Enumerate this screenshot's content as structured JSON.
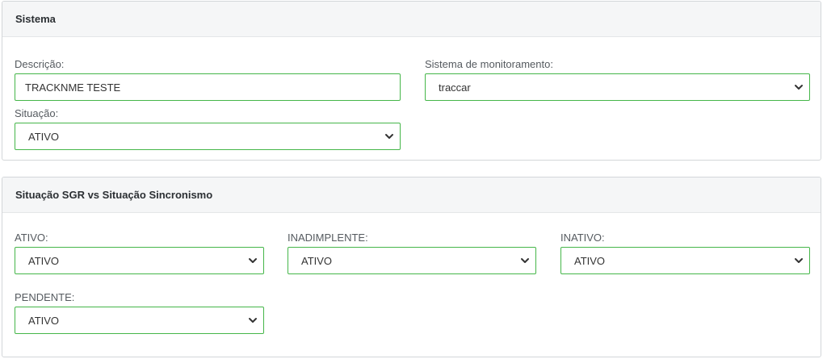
{
  "sistema": {
    "title": "Sistema",
    "descricao": {
      "label": "Descrição:",
      "value": "TRACKNME TESTE"
    },
    "sistema_monitoramento": {
      "label": "Sistema de monitoramento:",
      "value": "traccar"
    },
    "situacao": {
      "label": "Situação:",
      "value": "ATIVO"
    }
  },
  "sgr": {
    "title": "Situação SGR vs Situação Sincronismo",
    "ativo": {
      "label": "ATIVO:",
      "value": "ATIVO"
    },
    "inadimplente": {
      "label": "INADIMPLENTE:",
      "value": "ATIVO"
    },
    "inativo": {
      "label": "INATIVO:",
      "value": "ATIVO"
    },
    "pendente": {
      "label": "PENDENTE:",
      "value": "ATIVO"
    }
  },
  "theme": {
    "accent_border": "#45b649",
    "header_bg": "#f5f6f7"
  },
  "icons": {
    "select_arrow": "chevron-down-icon"
  }
}
